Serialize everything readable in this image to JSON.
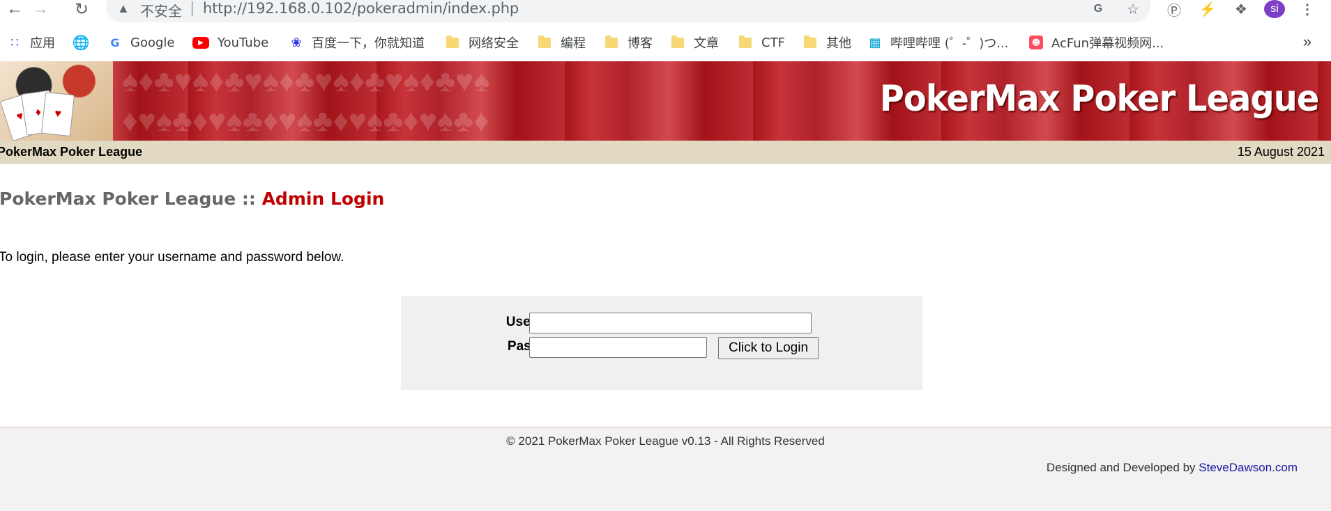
{
  "browser": {
    "address_bar": {
      "security_label": "不安全",
      "url": "http://192.168.0.102/pokeradmin/index.php"
    },
    "toolbar_icons": [
      "back-icon",
      "forward-icon",
      "reload-icon",
      "warning-icon",
      "translate-icon",
      "star-icon",
      "grammarly-icon",
      "extension-bolt-icon",
      "puzzle-icon",
      "menu-dots-icon"
    ],
    "profile_initials": "si",
    "bookmarks": [
      {
        "label": "应用",
        "icon": "apps-grid-icon"
      },
      {
        "label": "",
        "icon": "globe-icon"
      },
      {
        "label": "Google",
        "icon": "google-icon"
      },
      {
        "label": "YouTube",
        "icon": "youtube-icon"
      },
      {
        "label": "百度一下，你就知道",
        "icon": "baidu-icon"
      },
      {
        "label": "网络安全",
        "icon": "folder-icon"
      },
      {
        "label": "编程",
        "icon": "folder-icon"
      },
      {
        "label": "博客",
        "icon": "folder-icon"
      },
      {
        "label": "文章",
        "icon": "folder-icon"
      },
      {
        "label": "CTF",
        "icon": "folder-icon"
      },
      {
        "label": "其他",
        "icon": "folder-icon"
      },
      {
        "label": "哔哩哔哩 (゜-゜)つ...",
        "icon": "bilibili-icon"
      },
      {
        "label": "AcFun弹幕视频网...",
        "icon": "acfun-icon"
      }
    ],
    "bookmarks_overflow": "»"
  },
  "site": {
    "banner_title": "PokerMax Poker League",
    "infobar": {
      "site_name": "PokerMax Poker League",
      "date": "15 August 2021"
    },
    "heading": {
      "prefix": "PokerMax Poker League ::",
      "page": "Admin Login"
    },
    "intro": "To login, please enter your username and password below.",
    "login_form": {
      "username_label": "Username:",
      "username_value": "",
      "password_label": "Password:",
      "password_value": "",
      "submit_label": "Click to Login"
    },
    "footer": {
      "copyright": "© 2021 PokerMax Poker League v0.13 - All Rights Reserved",
      "credit_prefix": "Designed and Developed by",
      "credit_link": "SteveDawson.com"
    }
  },
  "colors": {
    "accent_red": "#c00000",
    "banner_red": "#b0222a",
    "infobar_bg": "#e2d9c3",
    "link_blue": "#1a1aa6",
    "avatar_purple": "#7d3fc7"
  }
}
